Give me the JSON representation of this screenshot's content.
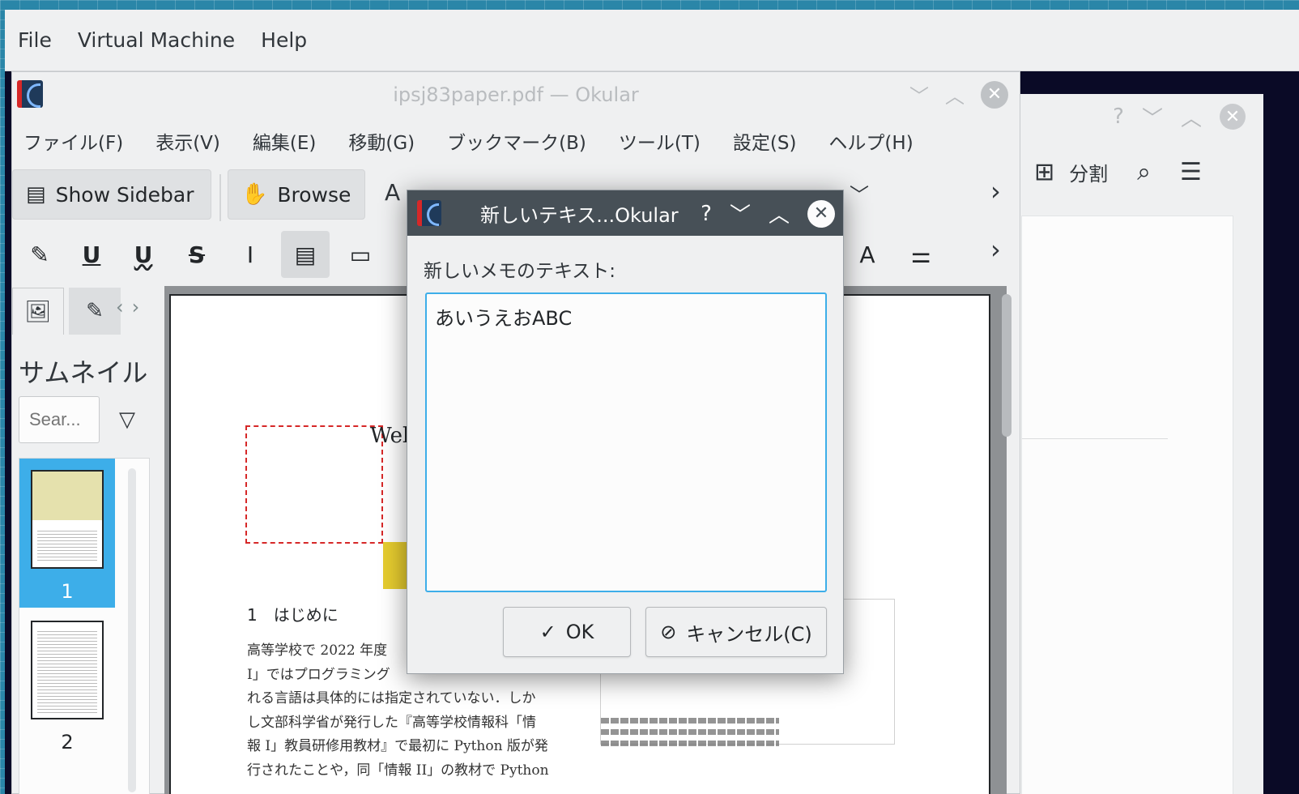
{
  "vm": {
    "menu": [
      "File",
      "Virtual Machine",
      "Help"
    ]
  },
  "bg_window": {
    "title_help": "?",
    "title_min": "﹀",
    "title_max": "︿",
    "title_close": "✕",
    "split_label": "分割"
  },
  "okular": {
    "title": "ipsj83paper.pdf — Okular",
    "menu": [
      "ファイル(F)",
      "表示(V)",
      "編集(E)",
      "移動(G)",
      "ブックマーク(B)",
      "ツール(T)",
      "設定(S)",
      "ヘルプ(H)"
    ],
    "toolbar": {
      "show_sidebar": "Show Sidebar",
      "browse": "Browse",
      "text_select_glyph": "A"
    },
    "sidebar": {
      "title": "サムネイル",
      "search_placeholder": "Sear...",
      "thumbnails": [
        "1",
        "2"
      ]
    },
    "page": {
      "heading_word": "Web",
      "section_heading": "1　はじめに",
      "body_lines": [
        "高等学校で 2022 年度",
        "I」ではプログラミング",
        "れる言語は具体的には指定されていない．しか",
        "し文部科学省が発行した『高等学校情報科「情",
        "報 I」教員研修用教材』で最初に Python 版が発",
        "行されたことや，同「情報 II」の教材で Python"
      ]
    }
  },
  "dialog": {
    "title": "新しいテキス...Okular",
    "help": "?",
    "label": "新しいメモのテキスト:",
    "text": "あいうえおABC",
    "ok": "OK",
    "cancel": "キャンセル(C)"
  },
  "colors": {
    "accent": "#3daee9",
    "dialog_title_bg": "#475057",
    "annotation_border": "#d62828",
    "highlight_yellow": "#e6cc2f"
  }
}
